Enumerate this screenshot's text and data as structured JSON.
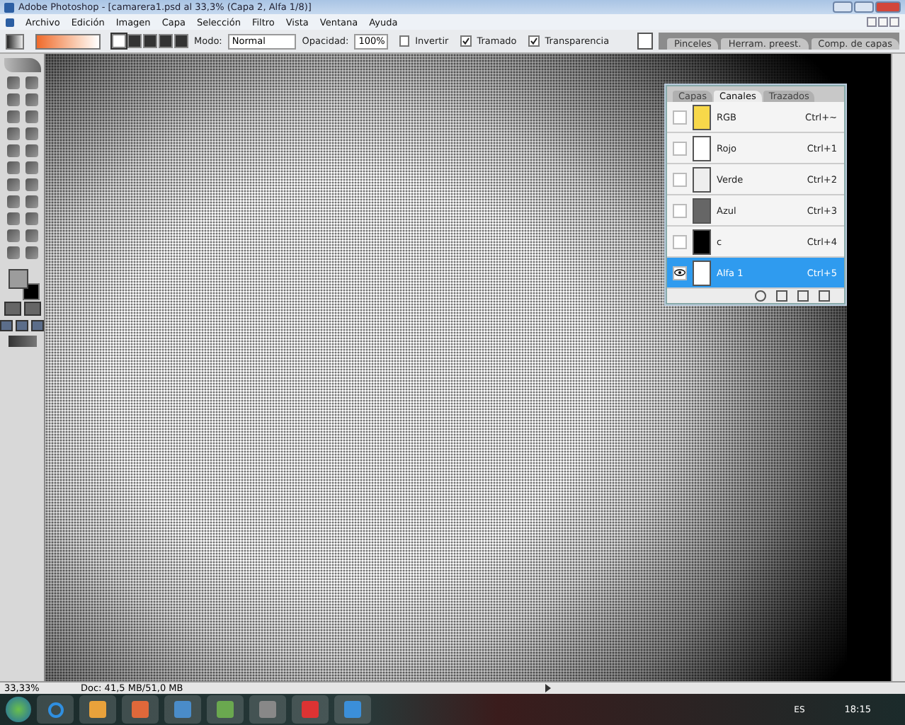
{
  "window": {
    "title": "Adobe Photoshop - [camarera1.psd al 33,3% (Capa 2, Alfa 1/8)]"
  },
  "menu": [
    "Archivo",
    "Edición",
    "Imagen",
    "Capa",
    "Selección",
    "Filtro",
    "Vista",
    "Ventana",
    "Ayuda"
  ],
  "options_bar": {
    "mode_label": "Modo:",
    "mode": "Normal",
    "opacity_label": "Opacidad:",
    "opacity": "100%",
    "checkboxes": [
      {
        "label": "Invertir",
        "checked": false
      },
      {
        "label": "Tramado",
        "checked": true
      },
      {
        "label": "Transparencia",
        "checked": true
      }
    ],
    "well_tabs": [
      "Pinceles",
      "Herram. preest.",
      "Comp. de capas"
    ]
  },
  "channels_panel": {
    "tabs": [
      {
        "label": "Capas",
        "selected": false
      },
      {
        "label": "Canales",
        "selected": true
      },
      {
        "label": "Trazados",
        "selected": false
      }
    ],
    "channels": [
      {
        "name": "RGB",
        "shortcut": "Ctrl+~",
        "color": "#f7d84a",
        "visible": false,
        "selected": false
      },
      {
        "name": "Rojo",
        "shortcut": "Ctrl+1",
        "color": "#ffffff",
        "visible": false,
        "selected": false
      },
      {
        "name": "Verde",
        "shortcut": "Ctrl+2",
        "color": "#eeeeee",
        "visible": false,
        "selected": false
      },
      {
        "name": "Azul",
        "shortcut": "Ctrl+3",
        "color": "#666666",
        "visible": false,
        "selected": false
      },
      {
        "name": "c",
        "shortcut": "Ctrl+4",
        "color": "#000000",
        "visible": false,
        "selected": false
      },
      {
        "name": "Alfa 1",
        "shortcut": "Ctrl+5",
        "color": "#ffffff",
        "visible": true,
        "selected": true
      }
    ]
  },
  "status_bar": {
    "zoom": "33,33%",
    "doc": "Doc: 41,5 MB/51,0 MB"
  },
  "taskbar": {
    "language": "ES",
    "time": "18:15"
  }
}
